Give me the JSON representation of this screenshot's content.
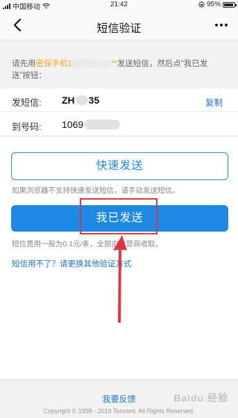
{
  "status_bar": {
    "carrier": "中国移动",
    "time": "21:42",
    "battery_text": "95%"
  },
  "nav": {
    "title": "短信验证"
  },
  "instruction": {
    "prefix": "请先用",
    "phone_highlight_start": "密保手机1",
    "phone_highlight_end": "**",
    "suffix": "发送短信，然后点“我已发送”按钮："
  },
  "sms_info": {
    "send_label": "发短信:",
    "send_prefix": "ZH",
    "send_suffix": "35",
    "copy_label": "复制",
    "to_label": "到号码:",
    "to_prefix": "1069"
  },
  "actions": {
    "quick_send_label": "快速发送",
    "quick_send_tip": "如果浏览器不支持快速发送短信，请手动发送短信。",
    "sent_label": "我已发送",
    "fee_tip": "短信费用一般为0.1元/条，全部由运营商收取。",
    "switch_link": "短信用不了？请更换其他验证方式"
  },
  "footer": {
    "feedback": "我要反馈",
    "copyright": "Copyright © 1998 - 2019 Tencent. All Rights Reserved.",
    "watermark": "Baidu 经验"
  },
  "colors": {
    "accent_blue": "#1e88e5",
    "highlight_orange": "#f5a623",
    "annotation_red": "#d9363e"
  }
}
